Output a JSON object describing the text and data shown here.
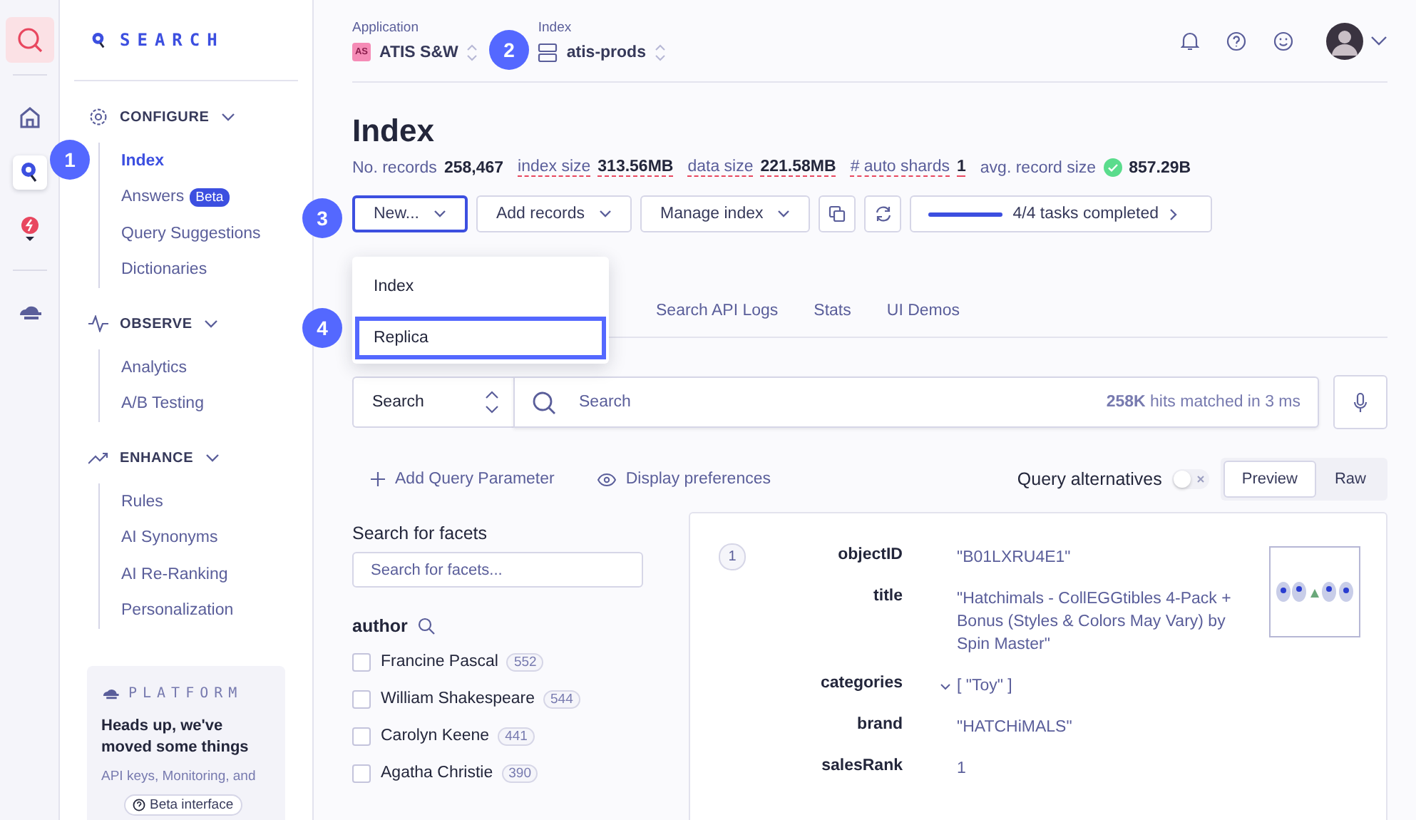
{
  "rail": {
    "items": [
      {
        "kind": "search",
        "selected": false,
        "current": true
      },
      {
        "kind": "home",
        "selected": false,
        "current": false
      },
      {
        "kind": "pin",
        "selected": true,
        "current": false
      },
      {
        "kind": "bulb",
        "selected": false,
        "current": false
      },
      {
        "kind": "cloud",
        "selected": false,
        "current": false
      }
    ]
  },
  "sidebar": {
    "logo": "SEARCH",
    "sections": [
      {
        "title": "CONFIGURE",
        "kind": "gear",
        "expanded": true,
        "items": [
          {
            "label": "Index",
            "selected": true
          },
          {
            "label": "Answers",
            "badge": "Beta",
            "selected": false
          },
          {
            "label": "Query Suggestions",
            "selected": false
          },
          {
            "label": "Dictionaries",
            "selected": false
          }
        ]
      },
      {
        "title": "OBSERVE",
        "kind": "pulse",
        "expanded": true,
        "items": [
          {
            "label": "Analytics",
            "selected": false
          },
          {
            "label": "A/B Testing",
            "selected": false
          }
        ]
      },
      {
        "title": "ENHANCE",
        "kind": "trend",
        "expanded": true,
        "items": [
          {
            "label": "Rules",
            "selected": false
          },
          {
            "label": "AI Synonyms",
            "selected": false
          },
          {
            "label": "AI Re-Ranking",
            "selected": false
          },
          {
            "label": "Personalization",
            "selected": false
          }
        ]
      }
    ],
    "platform": {
      "logo": "PLATFORM",
      "heading": "Heads up, we've moved some things",
      "body": "API keys, Monitoring, and",
      "badge": "Beta interface"
    }
  },
  "header": {
    "application": {
      "label": "Application",
      "badge": "AS",
      "name": "ATIS S&W"
    },
    "index": {
      "label": "Index",
      "name": "atis-prods"
    }
  },
  "title": "Index",
  "stats": [
    {
      "label": "No. records",
      "value": "258,467",
      "underlined": false
    },
    {
      "label": "index size",
      "value": "313.56MB",
      "underlined": true
    },
    {
      "label": "data size",
      "value": "221.58MB",
      "underlined": true
    },
    {
      "label": "# auto shards",
      "value": "1",
      "underlined": true
    },
    {
      "label": "avg. record size",
      "value": "857.29B",
      "underlined": false,
      "ok": true
    }
  ],
  "actions": [
    {
      "label": "New...",
      "focused": true
    },
    {
      "label": "Add records",
      "focused": false
    },
    {
      "label": "Manage index",
      "focused": false
    }
  ],
  "tasks": {
    "level": 1,
    "text": "4/4 tasks completed"
  },
  "dropdown": {
    "items": [
      {
        "label": "Index",
        "focused": false
      },
      {
        "label": "Replica",
        "focused": true
      }
    ]
  },
  "tabs": [
    {
      "label": "Search API Logs",
      "selected": false
    },
    {
      "label": "Stats",
      "selected": false
    },
    {
      "label": "UI Demos",
      "selected": false
    }
  ],
  "search": {
    "mode": "Search",
    "placeholder": "Search",
    "hits": "**258K** hits matched in 3 ms"
  },
  "query": {
    "add": "Add Query Parameter",
    "display": "Display preferences",
    "alternatives": "Query alternatives",
    "alternatives_on": false,
    "views": [
      {
        "label": "Preview",
        "selected": true
      },
      {
        "label": "Raw",
        "selected": false
      }
    ]
  },
  "facets": {
    "title": "Search for facets",
    "placeholder": "Search for facets...",
    "name": "author",
    "values": [
      {
        "label": "Francine Pascal",
        "count": "552",
        "checked": false
      },
      {
        "label": "William Shakespeare",
        "count": "544",
        "checked": false
      },
      {
        "label": "Carolyn Keene",
        "count": "441",
        "checked": false
      },
      {
        "label": "Agatha Christie",
        "count": "390",
        "checked": false
      }
    ]
  },
  "hit": {
    "number": "1",
    "fields": [
      {
        "key": "objectID",
        "value": "\"B01LXRU4E1\""
      },
      {
        "key": "title",
        "value": "\"Hatchimals - CollEGGtibles 4-Pack + Bonus (Styles & Colors May Vary) by Spin Master\""
      },
      {
        "key": "categories",
        "value": "[ \"Toy\" ]",
        "expandable": true
      },
      {
        "key": "brand",
        "value": "\"HATCHiMALS\""
      },
      {
        "key": "salesRank",
        "value": "1"
      }
    ]
  },
  "annotations": [
    "1",
    "2",
    "3",
    "4"
  ]
}
